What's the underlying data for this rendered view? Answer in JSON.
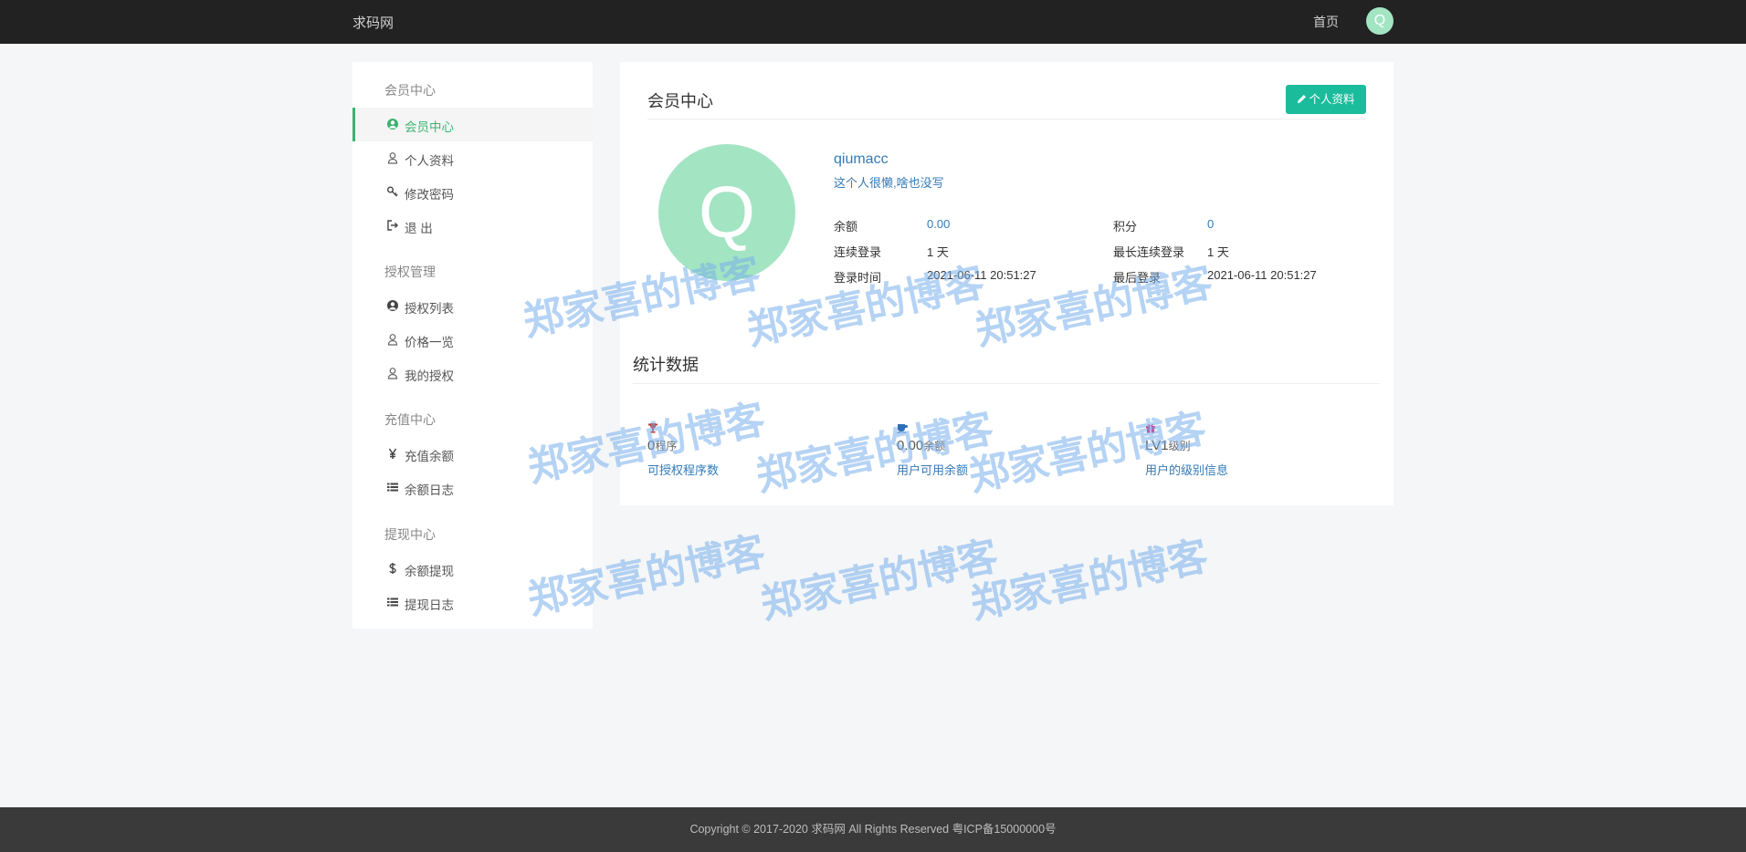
{
  "header": {
    "brand": "求码网",
    "nav_home": "首页",
    "avatar_letter": "Q"
  },
  "sidebar": {
    "groups": [
      {
        "title": "会员中心",
        "items": [
          {
            "label": "会员中心",
            "icon": "user-circle-icon",
            "active": true
          },
          {
            "label": "个人资料",
            "icon": "user-icon"
          },
          {
            "label": "修改密码",
            "icon": "key-icon"
          },
          {
            "label": "退 出",
            "icon": "sign-out-icon"
          }
        ]
      },
      {
        "title": "授权管理",
        "items": [
          {
            "label": "授权列表",
            "icon": "user-circle-icon"
          },
          {
            "label": "价格一览",
            "icon": "user-icon"
          },
          {
            "label": "我的授权",
            "icon": "user-icon"
          }
        ]
      },
      {
        "title": "充值中心",
        "items": [
          {
            "label": "充值余额",
            "icon": "yen-icon"
          },
          {
            "label": "余额日志",
            "icon": "list-icon"
          }
        ]
      },
      {
        "title": "提现中心",
        "items": [
          {
            "label": "余额提现",
            "icon": "dollar-icon"
          },
          {
            "label": "提现日志",
            "icon": "list-icon"
          }
        ]
      }
    ]
  },
  "main": {
    "title": "会员中心",
    "profile_button": "个人资料",
    "avatar_letter": "Q",
    "username": "qiumacc",
    "bio": "这个人很懒,啥也没写",
    "info": {
      "balance_label": "余额",
      "balance_value": "0.00",
      "points_label": "积分",
      "points_value": "0",
      "streak_label": "连续登录",
      "streak_value": "1 天",
      "max_streak_label": "最长连续登录",
      "max_streak_value": "1 天",
      "login_time_label": "登录时间",
      "login_time_value": "2021-06-11 20:51:27",
      "last_login_label": "最后登录",
      "last_login_value": "2021-06-11 20:51:27"
    },
    "stats_title": "统计数据",
    "stats": [
      {
        "icon": "trophy-icon",
        "number": "0",
        "unit": "程序",
        "link": "可授权程序数"
      },
      {
        "icon": "coffee-icon",
        "number": "0.00",
        "unit": "余额",
        "link": "用户可用余额"
      },
      {
        "icon": "gift-icon",
        "number": "LV1",
        "unit": "级别",
        "link": "用户的级别信息"
      }
    ]
  },
  "footer": {
    "text": "Copyright © 2017-2020 求码网 All Rights Reserved 粤ICP备15000000号"
  },
  "watermark": {
    "text": "郑家喜的博客"
  },
  "colors": {
    "accent": "#3cb371",
    "button": "#1abc9c",
    "avatar": "#a3e4c3",
    "link": "#337ab7"
  }
}
